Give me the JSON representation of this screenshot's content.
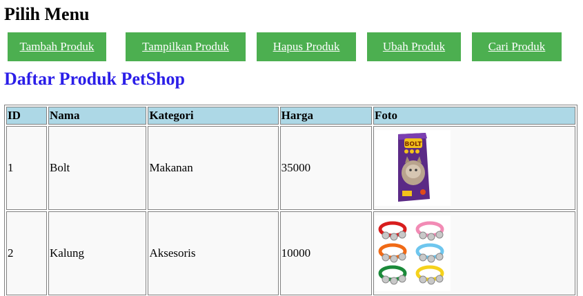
{
  "menu": {
    "title": "Pilih Menu",
    "buttons": [
      {
        "label": "Tambah Produk"
      },
      {
        "label": "Tampilkan Produk"
      },
      {
        "label": "Hapus Produk"
      },
      {
        "label": "Ubah Produk"
      },
      {
        "label": "Cari Produk"
      }
    ],
    "button_color": "#4caf50"
  },
  "list": {
    "title": "Daftar Produk PetShop",
    "title_color": "#2b1ee8"
  },
  "table": {
    "headers": [
      "ID",
      "Nama",
      "Kategori",
      "Harga",
      "Foto"
    ],
    "header_color": "#add8e6",
    "rows": [
      {
        "id": "1",
        "nama": "Bolt",
        "kategori": "Makanan",
        "harga": "35000",
        "foto_icon": "cat-food-bag-image"
      },
      {
        "id": "2",
        "nama": "Kalung",
        "kategori": "Aksesoris",
        "harga": "10000",
        "foto_icon": "bell-collars-image"
      }
    ]
  }
}
